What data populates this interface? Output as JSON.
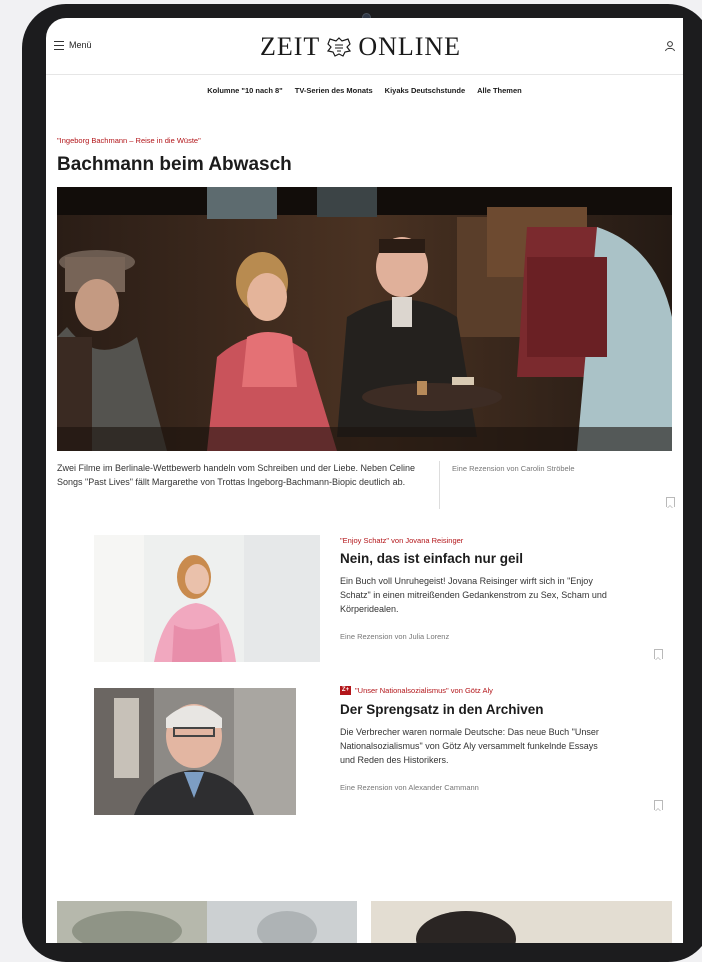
{
  "header": {
    "menu_label": "Menü",
    "logo_left": "ZEIT",
    "logo_right": "ONLINE"
  },
  "nav": {
    "items": [
      "Kolumne \"10 nach 8\"",
      "TV-Serien des Monats",
      "Kiyaks Deutschstunde",
      "Alle Themen"
    ]
  },
  "lead": {
    "kicker": "\"Ingeborg Bachmann – Reise in die Wüste\"",
    "title": "Bachmann beim Abwasch",
    "teaser": "Zwei Filme im Berlinale-Wettbewerb handeln vom Schreiben und der Liebe. Neben Celine Songs \"Past Lives\" fällt Margarethe von Trottas Ingeborg-Bachmann-Biopic deutlich ab.",
    "author": "Eine Rezension von Carolin Ströbele"
  },
  "articles": [
    {
      "kicker": "\"Enjoy Schatz\" von Jovana Reisinger",
      "title": "Nein, das ist einfach nur geil",
      "text": "Ein Buch voll Unruhegeist! Jovana Reisinger wirft sich in \"Enjoy Schatz\" in einen mitreißenden Gedankenstrom zu Sex, Scham und Körperidealen.",
      "author": "Eine Rezension von Julia Lorenz",
      "zplus": false
    },
    {
      "kicker": "\"Unser Nationalsozialismus\" von Götz Aly",
      "title": "Der Sprengsatz in den Archiven",
      "text": "Die Verbrecher waren normale Deutsche: Das neue Buch \"Unser Nationalsozialismus\" von Götz Aly versammelt funkelnde Essays und Reden des Historikers.",
      "author": "Eine Rezension von Alexander Cammann",
      "zplus": true,
      "zplus_label": "Z+"
    }
  ],
  "colors": {
    "accent_red": "#b3161a",
    "text": "#1c1c1c",
    "bezel": "#1c1c1e"
  }
}
